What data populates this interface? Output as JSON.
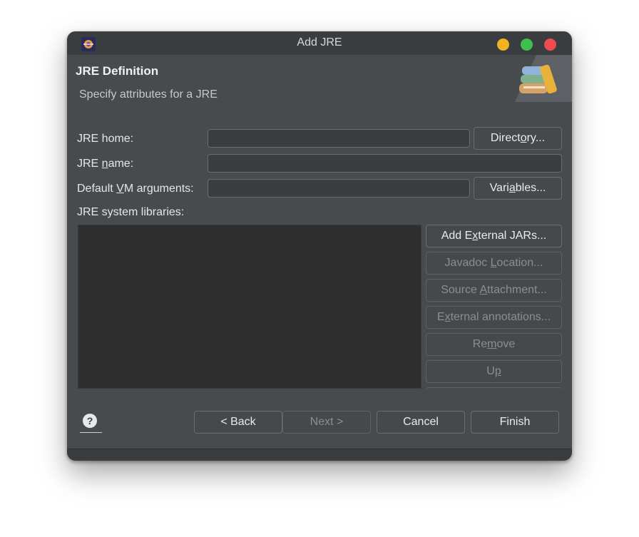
{
  "window": {
    "title": "Add JRE",
    "controls": [
      "minimize",
      "maximize",
      "close"
    ],
    "colors": {
      "minimize": "#f4b124",
      "maximize": "#3fbf4b",
      "close": "#ee4b50"
    }
  },
  "header": {
    "title": "JRE Definition",
    "subtitle": "Specify attributes for a JRE",
    "banner_icon": "books-icon"
  },
  "form": {
    "jre_home": {
      "label": "JRE home:",
      "value": "",
      "button": "Directory..."
    },
    "jre_name": {
      "label": "JRE name:",
      "value": ""
    },
    "vm_args": {
      "label": "Default VM arguments:",
      "value": "",
      "button": "Variables..."
    }
  },
  "libraries": {
    "label": "JRE system libraries:",
    "items": [],
    "buttons": [
      {
        "label": "Add External JARs...",
        "enabled": true
      },
      {
        "label": "Javadoc Location...",
        "enabled": false
      },
      {
        "label": "Source Attachment...",
        "enabled": false
      },
      {
        "label": "External annotations...",
        "enabled": false
      },
      {
        "label": "Remove",
        "enabled": false
      },
      {
        "label": "Up",
        "enabled": false
      }
    ]
  },
  "footer": {
    "help_icon": "help-icon",
    "back": "< Back",
    "next": "Next >",
    "cancel": "Cancel",
    "finish": "Finish"
  }
}
